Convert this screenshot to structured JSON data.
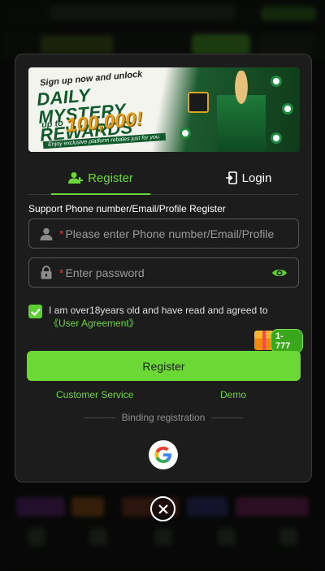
{
  "banner": {
    "line1": "Sign up now and unlock",
    "title": "DAILY MYSTERY REWARDS",
    "upto": "up to",
    "amount": "100,000!",
    "note": "Enjoy exclusive platform rebates just for you."
  },
  "tabs": [
    {
      "label": "Register",
      "active": true,
      "icon": "add-user-icon"
    },
    {
      "label": "Login",
      "active": false,
      "icon": "login-icon"
    }
  ],
  "form": {
    "support_label": "Support Phone number/Email/Profile Register",
    "account": {
      "required_mark": "*",
      "placeholder": "Please enter Phone number/Email/Profile",
      "value": "",
      "icon": "user-icon"
    },
    "password": {
      "required_mark": "*",
      "placeholder": "Enter password",
      "value": "",
      "icon": "lock-icon",
      "toggle_icon": "eye-icon"
    },
    "agreement": {
      "checked": true,
      "text": "I am over18years old and have read and agreed to ",
      "link": "《User Agreement》"
    },
    "bonus_badge": "1-777",
    "submit_label": "Register"
  },
  "links": {
    "customer_service": "Customer Service",
    "demo": "Demo"
  },
  "binding_label": "Binding registration",
  "social": [
    {
      "name": "Google",
      "icon": "google-icon"
    }
  ],
  "close_icon": "close-icon",
  "colors": {
    "accent": "#6ad83a",
    "button": "#6cd836",
    "modal_bg": "#1c1c1c",
    "required": "#e8362f"
  }
}
